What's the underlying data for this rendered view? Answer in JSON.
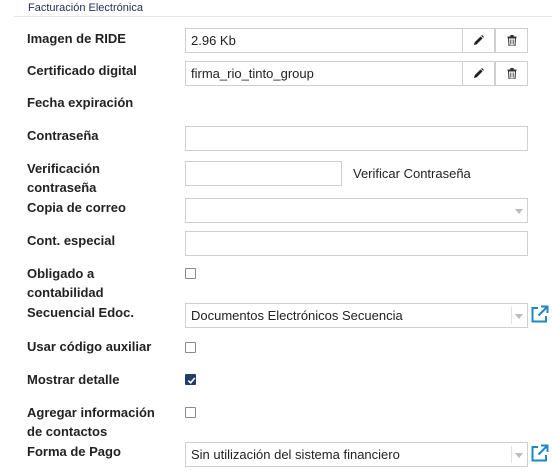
{
  "section": {
    "title": "Facturación Electrónica"
  },
  "fields": {
    "imagen_ride": {
      "label": "Imagen de RIDE",
      "value": "2.96 Kb"
    },
    "certificado": {
      "label": "Certificado digital",
      "value": "firma_rio_tinto_group"
    },
    "fecha_expiracion": {
      "label": "Fecha expiración"
    },
    "contrasena": {
      "label": "Contraseña",
      "value": ""
    },
    "verificacion": {
      "label_line1": "Verificación",
      "label_line2": "contraseña",
      "value": "",
      "link": "Verificar Contraseña"
    },
    "copia_correo": {
      "label": "Copia de correo",
      "value": ""
    },
    "cont_especial": {
      "label": "Cont. especial",
      "value": ""
    },
    "obligado": {
      "label_line1": "Obligado a",
      "label_line2": "contabilidad",
      "checked": false
    },
    "secuencial": {
      "label": "Secuencial Edoc.",
      "value": "Documentos Electrónicos Secuencia"
    },
    "usar_codigo": {
      "label": "Usar código auxiliar",
      "checked": false
    },
    "mostrar_detalle": {
      "label": "Mostrar detalle",
      "checked": true
    },
    "agregar_info": {
      "label_line1": "Agregar información",
      "label_line2": "de contactos",
      "checked": false
    },
    "forma_pago": {
      "label": "Forma de Pago",
      "value": "Sin utilización del sistema financiero"
    }
  },
  "icons": {
    "edit": "pencil-icon",
    "delete": "trash-icon",
    "external": "external-link-icon",
    "check": "checkmark-icon"
  },
  "colors": {
    "accent": "#1e88c7",
    "checkbox_checked": "#233d6b",
    "title": "#1f2d5a"
  }
}
